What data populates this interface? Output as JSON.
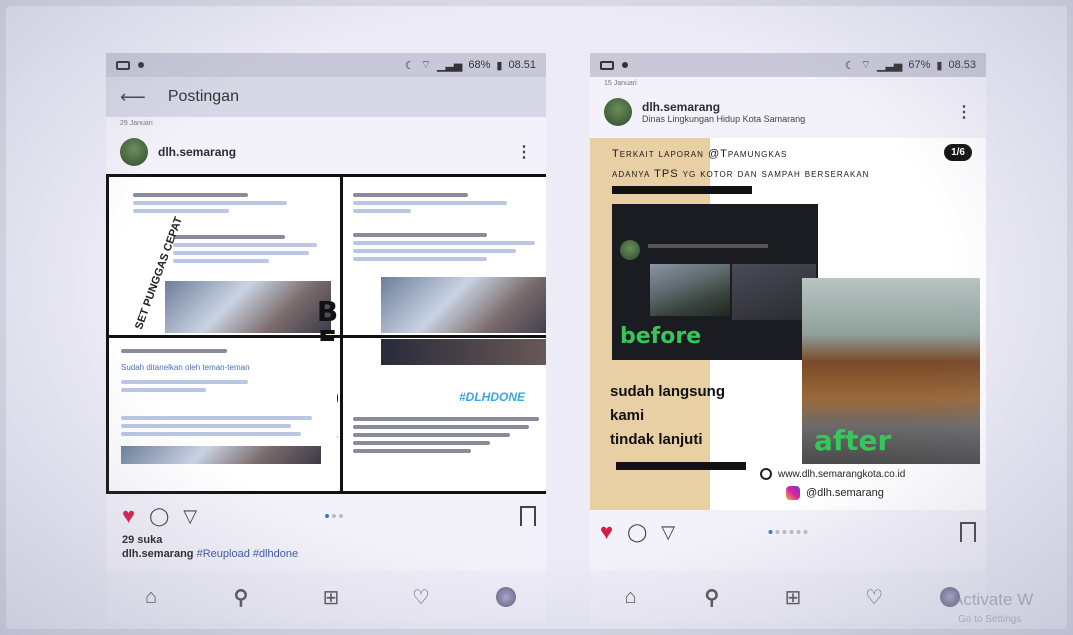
{
  "left_phone": {
    "status_time": "08.51",
    "status_battery": "68%",
    "appbar_title": "Postingan",
    "date_small": "29 Januari",
    "username": "dlh.semarang",
    "image": {
      "before_label": "BEFORE",
      "side_label": "SET PUNGGAS CEPAT",
      "tag_label": "#DLHDONE",
      "tweet_text": "Sudah ditanelkan oleh teman-teman"
    },
    "likes": "29 suka",
    "caption_user": "dlh.semarang",
    "caption_tags": "#Reupload #dlhdone"
  },
  "right_phone": {
    "status_time": "08.53",
    "status_battery": "67%",
    "date_small": "15 Januari",
    "username": "dlh.semarang",
    "user_subtitle": "Dinas Lingkungan Hidup Kota Samarang",
    "page_badge": "1/6",
    "image": {
      "title_line1": "Terkait laporan @Tpamungkas",
      "title_line2": "adanya TPS yg kotor dan sampah berserakan",
      "before_label": "before",
      "after_label": "after",
      "sudah_line1": "sudah langsung",
      "sudah_line2": "kami",
      "sudah_line3": "tindak lanjuti",
      "website": "www.dlh.semarangkota.co.id",
      "instagram": "@dlh.semarang"
    }
  },
  "watermark": {
    "line1": "Activate W",
    "line2": "Go to Settings"
  },
  "colors": {
    "heart": "#d81b4a",
    "label_green": "#34c759",
    "tag_blue": "#3aa7e0",
    "tan": "#e8cfa4"
  }
}
